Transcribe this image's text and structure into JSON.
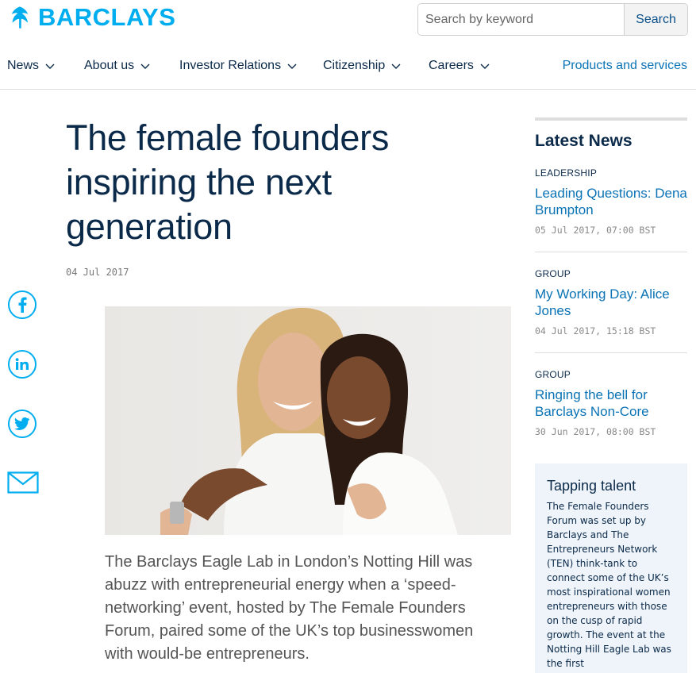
{
  "header": {
    "brand": "BARCLAYS",
    "search_placeholder": "Search by keyword",
    "search_button": "Search"
  },
  "nav": {
    "items": [
      {
        "label": "News"
      },
      {
        "label": "About us"
      },
      {
        "label": "Investor Relations"
      },
      {
        "label": "Citizenship"
      },
      {
        "label": "Careers"
      }
    ],
    "right_link": "Products and services"
  },
  "social": {
    "icons": [
      "facebook-icon",
      "linkedin-icon",
      "twitter-icon",
      "email-icon"
    ]
  },
  "article": {
    "title": "The female founders inspiring the next generation",
    "date": "04 Jul 2017",
    "lead": "The Barclays Eagle Lab in London’s Notting Hill was abuzz with entrepreneurial energy when a ‘speed-networking’ event, hosted by The Female Founders Forum, paired some of the UK’s top businesswomen with would-be entrepreneurs."
  },
  "sidebar": {
    "heading": "Latest News",
    "items": [
      {
        "category": "LEADERSHIP",
        "title": "Leading Questions: Dena Brumpton",
        "date": "05 Jul 2017, 07:00 BST"
      },
      {
        "category": "GROUP",
        "title": "My Working Day: Alice Jones",
        "date": "04 Jul 2017, 15:18 BST"
      },
      {
        "category": "GROUP",
        "title": "Ringing the bell for Barclays Non-Core",
        "date": "30 Jun 2017, 08:00 BST"
      }
    ],
    "callout": {
      "title": "Tapping talent",
      "body": "The Female Founders Forum was set up by Barclays and The Entrepreneurs Network (TEN) think-tank to connect some of the UK’s most inspirational women entrepreneurs with those on the cusp of rapid growth. The event at the Notting Hill Eagle Lab was the first"
    }
  },
  "colors": {
    "brand": "#00aeef",
    "navy": "#0b2a4a",
    "link": "#0a73b5"
  }
}
